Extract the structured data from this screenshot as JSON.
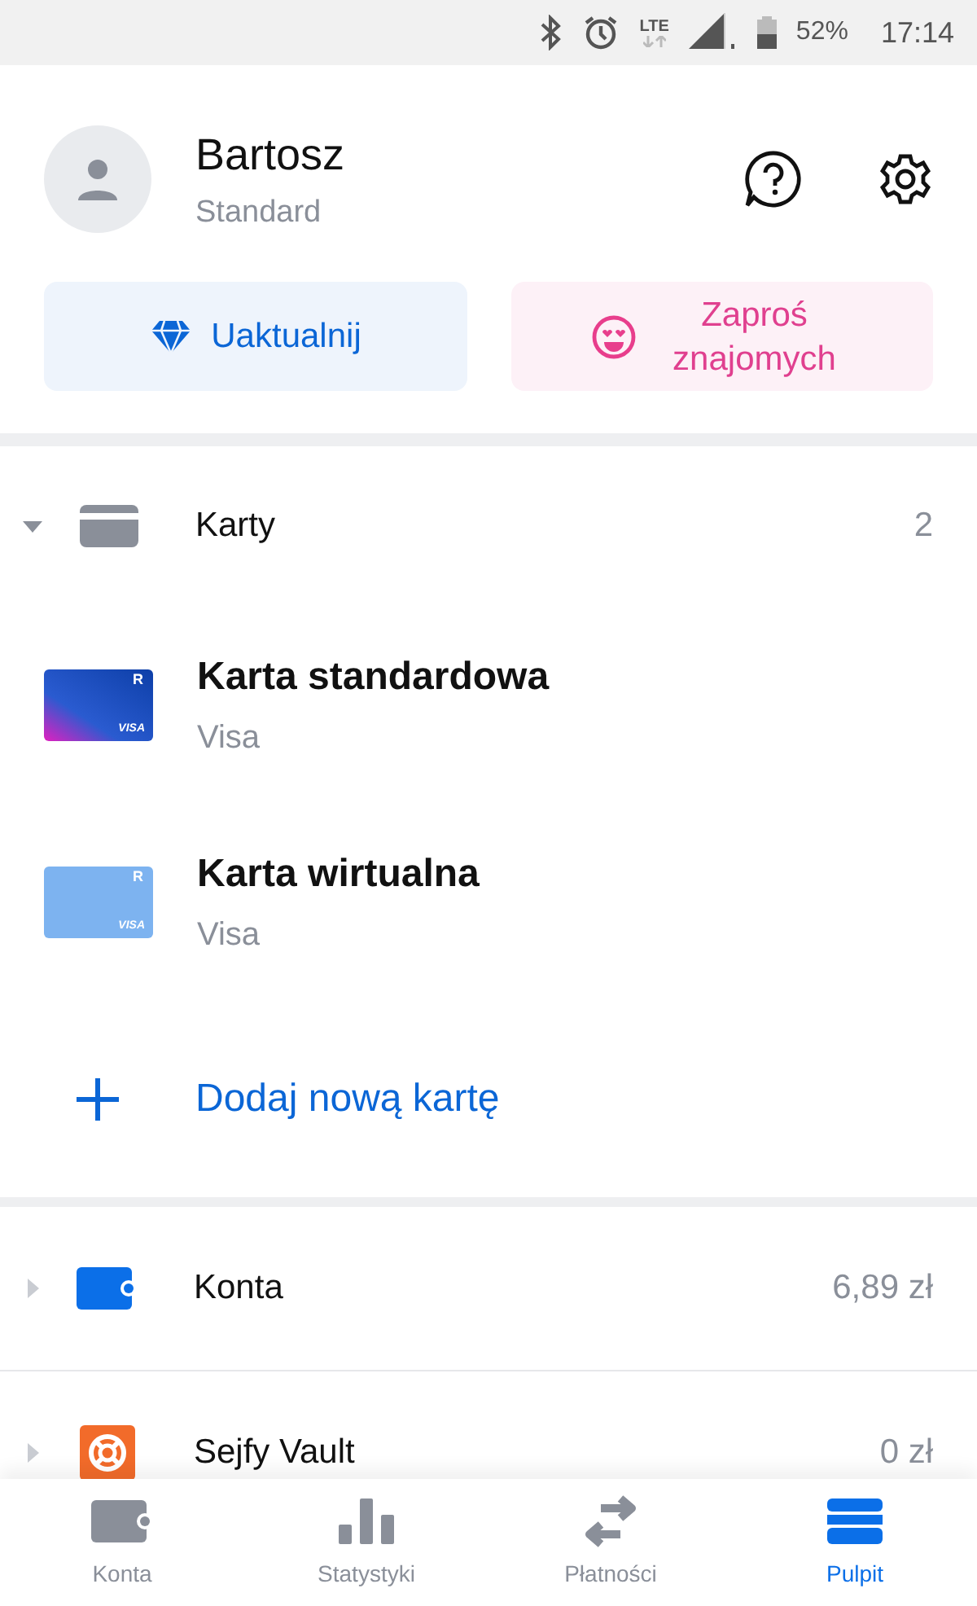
{
  "status_bar": {
    "network": "LTE",
    "battery": "52%",
    "time": "17:14"
  },
  "profile": {
    "name": "Bartosz",
    "plan": "Standard"
  },
  "actions": [
    {
      "kind": "upgrade",
      "label": "Uaktualnij"
    },
    {
      "kind": "invite",
      "label": "Zaproś znajomych"
    }
  ],
  "sections": [
    {
      "kind": "cards",
      "title": "Karty",
      "value": "2",
      "expanded": true,
      "cards": [
        {
          "kind": "standard",
          "name": "Karta standardowa",
          "network": "Visa",
          "logo": "R",
          "brand_mark": "VISA"
        },
        {
          "kind": "virtual",
          "name": "Karta wirtualna",
          "network": "Visa",
          "logo": "R",
          "brand_mark": "VISA"
        }
      ],
      "add_label": "Dodaj nową kartę"
    },
    {
      "kind": "accounts",
      "title": "Konta",
      "value": "6,89 zł",
      "expanded": false
    },
    {
      "kind": "vaults",
      "title": "Sejfy Vault",
      "value": "0 zł",
      "expanded": false
    }
  ],
  "bottom_nav": [
    {
      "kind": "wallet",
      "label": "Konta",
      "selected": false
    },
    {
      "kind": "stats",
      "label": "Statystyki",
      "selected": false
    },
    {
      "kind": "payments",
      "label": "Płatności",
      "selected": false
    },
    {
      "kind": "dashboard",
      "label": "Pulpit",
      "selected": true
    }
  ]
}
